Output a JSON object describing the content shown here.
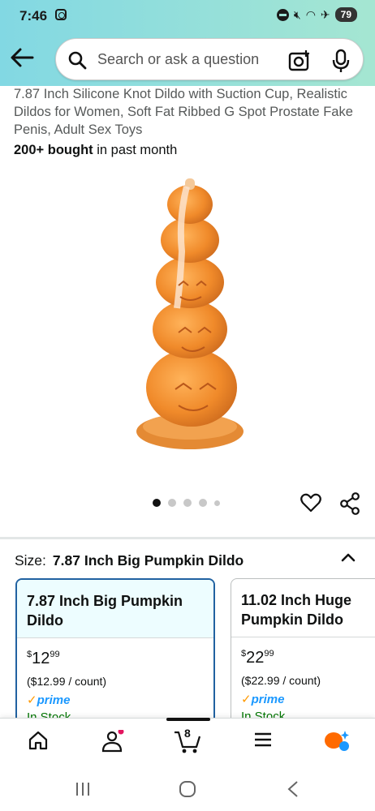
{
  "status_bar": {
    "time": "7:46",
    "battery": "79"
  },
  "search": {
    "placeholder": "Search or ask a question"
  },
  "product": {
    "title": "7.87 Inch Silicone Knot Dildo with Suction Cup, Realistic Dildos for Women, Soft Fat Ribbed G Spot Prostate Fake Penis, Adult Sex Toys",
    "bought_count": "200+ bought",
    "bought_suffix": " in past month"
  },
  "size": {
    "label": "Size:",
    "selected": "7.87 Inch Big Pumpkin Dildo"
  },
  "variants": [
    {
      "name": "7.87 Inch Big Pumpkin Dildo",
      "price_symbol": "$",
      "price_whole": "12",
      "price_fraction": "99",
      "unit_price": "($12.99 / count)",
      "prime": "prime",
      "stock": "In Stock"
    },
    {
      "name": "11.02 Inch Huge Pumpkin Dildo",
      "price_symbol": "$",
      "price_whole": "22",
      "price_fraction": "99",
      "unit_price": "($22.99 / count)",
      "prime": "prime",
      "stock": "In Stock"
    }
  ],
  "cart": {
    "count": "8"
  },
  "colors": {
    "header_start": "#82d8e3",
    "header_end": "#a5e6d2",
    "selected_border": "#2162a1",
    "prime_blue": "#1a98ff",
    "stock_green": "#007600"
  }
}
